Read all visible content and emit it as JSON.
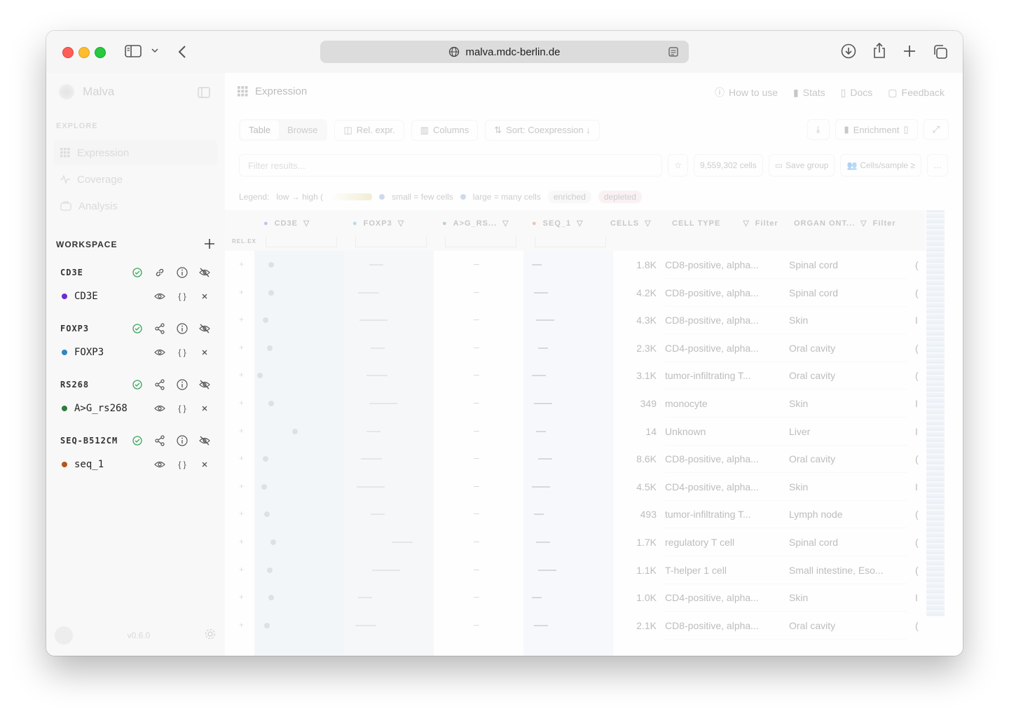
{
  "browser": {
    "url": "malva.mdc-berlin.de"
  },
  "sidebar": {
    "app_name": "Malva",
    "explore_label": "EXPLORE",
    "nav": [
      {
        "label": "Expression",
        "icon": "grid-icon",
        "active": true
      },
      {
        "label": "Coverage",
        "icon": "pulse-icon",
        "active": false
      },
      {
        "label": "Analysis",
        "icon": "briefcase-icon",
        "active": false
      }
    ],
    "workspace_label": "WORKSPACE",
    "groups": [
      {
        "name": "CD3E",
        "item": "CD3E",
        "color": "#6c2bd9"
      },
      {
        "name": "FOXP3",
        "item": "FOXP3",
        "color": "#2f86c2"
      },
      {
        "name": "RS268",
        "item": "A>G_rs268",
        "color": "#2e7d3a"
      },
      {
        "name": "SEQ-B512CM",
        "item": "seq_1",
        "color": "#b5541f"
      }
    ],
    "version": "v0.6.0"
  },
  "main": {
    "breadcrumb": "Expression",
    "links": [
      "How to use",
      "Stats",
      "Docs",
      "Feedback"
    ],
    "view_tabs": [
      "Table",
      "Browse"
    ],
    "buttons": {
      "rel_expr": "Rel. expr.",
      "columns": "Columns",
      "sort": "Sort: Coexpression ↓",
      "enrichment": "Enrichment"
    },
    "filter_placeholder": "Filter results...",
    "cell_count": "9,559,302 cells",
    "save_group": "Save group",
    "cells_per_sample": "Cells/sample ≥",
    "legend": {
      "label": "Legend:",
      "scale": "low → high (",
      "small": "small = few cells",
      "large": "large = many cells",
      "enriched": "enriched",
      "depleted": "depleted"
    },
    "columns": {
      "cd3e": "CD3E",
      "foxp3": "FOXP3",
      "ag": "A>G_RS...",
      "seq": "SEQ_1",
      "cells": "CELLS",
      "cell_type": "CELL TYPE",
      "organ": "ORGAN ONT...",
      "filter": "Filter",
      "rel_ex": "REL.EX"
    },
    "rows": [
      {
        "cells": "1.8K",
        "cell_type": "CD8-positive, alpha...",
        "organ": "Spinal cord",
        "last": "("
      },
      {
        "cells": "4.2K",
        "cell_type": "CD8-positive, alpha...",
        "organ": "Spinal cord",
        "last": "("
      },
      {
        "cells": "4.3K",
        "cell_type": "CD8-positive, alpha...",
        "organ": "Skin",
        "last": "I"
      },
      {
        "cells": "2.3K",
        "cell_type": "CD4-positive, alpha...",
        "organ": "Oral cavity",
        "last": "("
      },
      {
        "cells": "3.1K",
        "cell_type": "tumor-infiltrating T...",
        "organ": "Oral cavity",
        "last": "("
      },
      {
        "cells": "349",
        "cell_type": "monocyte",
        "organ": "Skin",
        "last": "I"
      },
      {
        "cells": "14",
        "cell_type": "Unknown",
        "organ": "Liver",
        "last": "I"
      },
      {
        "cells": "8.6K",
        "cell_type": "CD8-positive, alpha...",
        "organ": "Oral cavity",
        "last": "("
      },
      {
        "cells": "4.5K",
        "cell_type": "CD4-positive, alpha...",
        "organ": "Skin",
        "last": "I"
      },
      {
        "cells": "493",
        "cell_type": "tumor-infiltrating T...",
        "organ": "Lymph node",
        "last": "("
      },
      {
        "cells": "1.7K",
        "cell_type": "regulatory T cell",
        "organ": "Spinal cord",
        "last": "("
      },
      {
        "cells": "1.1K",
        "cell_type": "T-helper 1 cell",
        "organ": "Small intestine, Eso...",
        "last": "("
      },
      {
        "cells": "1.0K",
        "cell_type": "CD4-positive, alpha...",
        "organ": "Skin",
        "last": "I"
      },
      {
        "cells": "2.1K",
        "cell_type": "CD8-positive, alpha...",
        "organ": "Oral cavity",
        "last": "("
      }
    ]
  }
}
